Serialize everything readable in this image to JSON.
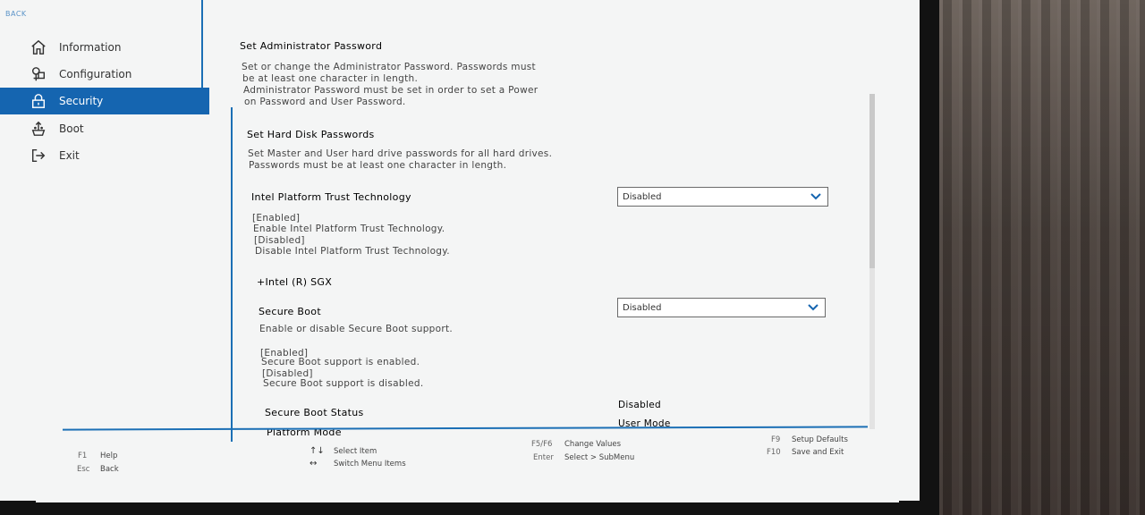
{
  "nav": {
    "back": "BACK",
    "items": [
      {
        "label": "Information",
        "icon": "home-icon"
      },
      {
        "label": "Configuration",
        "icon": "configuration-icon"
      },
      {
        "label": "Security",
        "icon": "lock-icon",
        "active": true
      },
      {
        "label": "Boot",
        "icon": "boot-icon"
      },
      {
        "label": "Exit",
        "icon": "exit-icon"
      }
    ]
  },
  "content": {
    "admin_password": {
      "title": "Set Administrator Password",
      "desc": [
        "Set or change the Administrator Password. Passwords must",
        "be at least one character in length.",
        "Administrator Password must be set in order to set a Power",
        "on Password and User Password."
      ]
    },
    "hdd_password": {
      "title": "Set Hard Disk Passwords",
      "desc": [
        "Set Master and User hard drive passwords for all hard drives.",
        "Passwords must be at least one character in length."
      ]
    },
    "ptt": {
      "title": "Intel Platform Trust Technology",
      "value": "Disabled",
      "desc": [
        "[Enabled]",
        "Enable Intel Platform Trust Technology.",
        "[Disabled]",
        "Disable Intel Platform Trust Technology."
      ]
    },
    "sgx": {
      "title": "+Intel (R) SGX"
    },
    "secure_boot": {
      "title": "Secure Boot",
      "value": "Disabled",
      "desc": [
        "Enable or disable Secure Boot support.",
        "[Enabled]",
        "Secure Boot support is enabled.",
        "[Disabled]",
        "Secure Boot support is disabled."
      ]
    },
    "secure_boot_status": {
      "title": "Secure Boot Status",
      "value": "Disabled"
    },
    "platform_mode": {
      "title": "Platform Mode",
      "value": "User Mode"
    }
  },
  "footer": [
    {
      "key": "F1",
      "label": "Help"
    },
    {
      "key": "Esc",
      "label": "Back"
    },
    {
      "key": "↑↓",
      "label": "Select Item"
    },
    {
      "key": "↔",
      "label": "Switch Menu Items"
    },
    {
      "key": "F5/F6",
      "label": "Change Values"
    },
    {
      "key": "Enter",
      "label": "Select > SubMenu"
    },
    {
      "key": "F9",
      "label": "Setup Defaults"
    },
    {
      "key": "F10",
      "label": "Save and Exit"
    }
  ],
  "colors": {
    "accent": "#1565b0",
    "background": "#f4f5f5"
  }
}
